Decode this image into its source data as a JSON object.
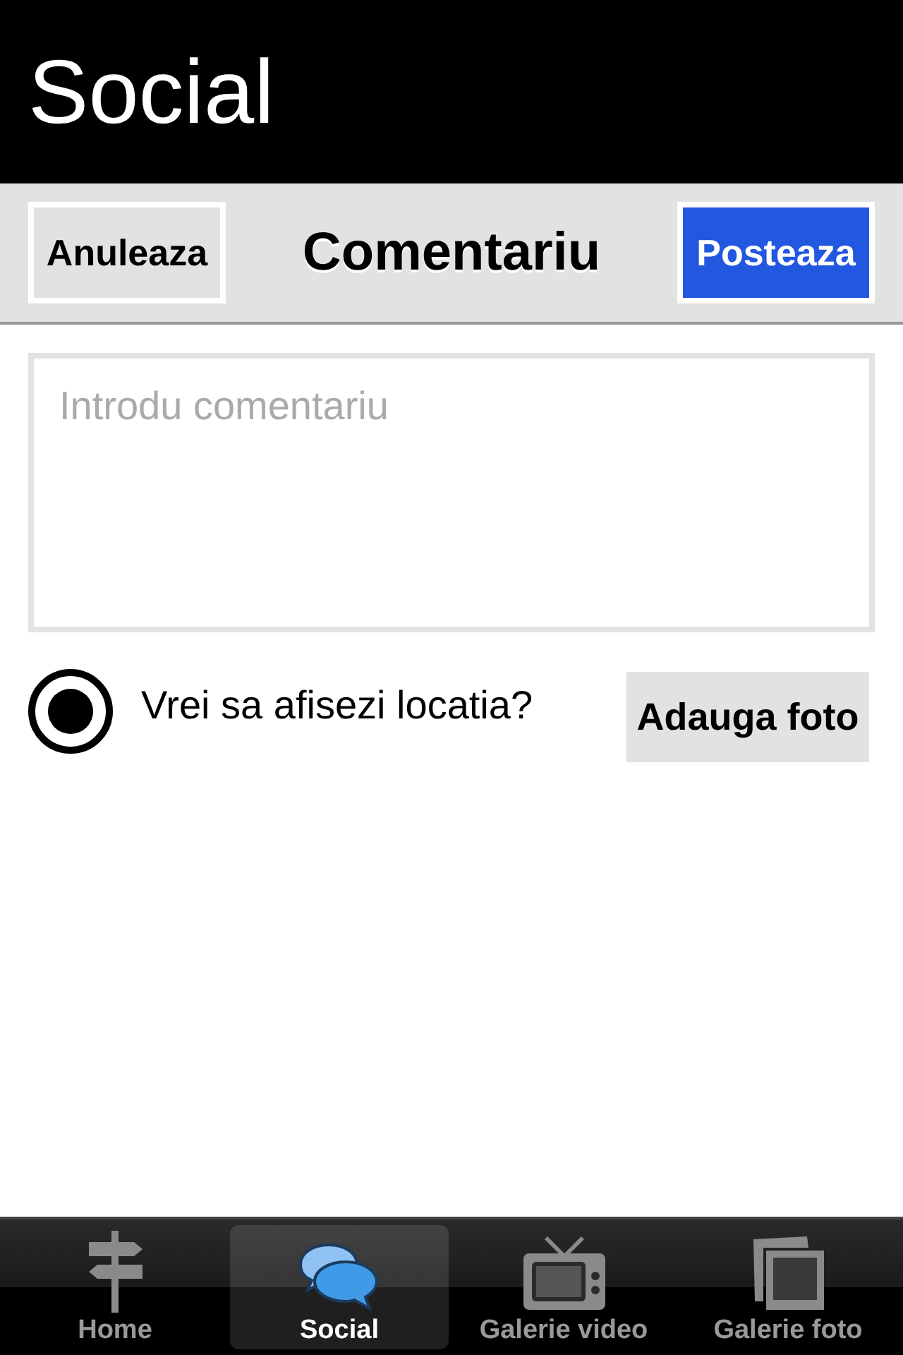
{
  "header": {
    "title": "Social"
  },
  "toolbar": {
    "cancel": "Anuleaza",
    "title": "Comentariu",
    "post": "Posteaza"
  },
  "comment": {
    "placeholder": "Introdu comentariu"
  },
  "location": {
    "label": "Vrei sa afisezi locatia?",
    "checked": true
  },
  "add_photo": "Adauga foto",
  "tabs": [
    {
      "label": "Home",
      "selected": false
    },
    {
      "label": "Social",
      "selected": true
    },
    {
      "label": "Galerie video",
      "selected": false
    },
    {
      "label": "Galerie foto",
      "selected": false
    }
  ]
}
